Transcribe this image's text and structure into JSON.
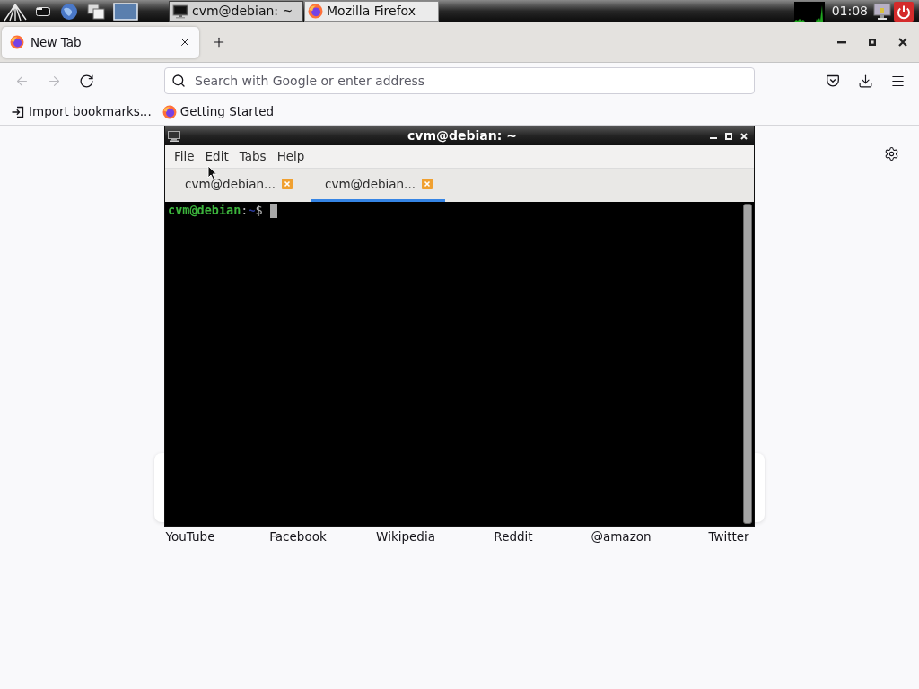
{
  "taskbar": {
    "tasks": [
      {
        "title": "cvm@debian: ~",
        "kind": "terminal",
        "selected": true
      },
      {
        "title": "Mozilla Firefox",
        "kind": "firefox",
        "selected": false
      }
    ],
    "clock": "01:08"
  },
  "browser": {
    "tabs": [
      {
        "title": "New Tab",
        "selected": true
      }
    ],
    "nav_buttons": [
      {
        "kind": "back",
        "disabled": true
      },
      {
        "kind": "forward",
        "disabled": true
      },
      {
        "kind": "reload",
        "disabled": false
      }
    ],
    "address_bar": {
      "placeholder": "Search with Google or enter address"
    },
    "bookmarks": [
      {
        "label": "Import bookmarks...",
        "kind": "import"
      },
      {
        "label": "Getting Started",
        "kind": "firefox"
      }
    ],
    "shortcuts": [
      {
        "label": "YouTube"
      },
      {
        "label": "Facebook"
      },
      {
        "label": "Wikipedia"
      },
      {
        "label": "Reddit"
      },
      {
        "label": "@amazon"
      },
      {
        "label": "Twitter"
      }
    ]
  },
  "terminal": {
    "title": "cvm@debian: ~",
    "menu": [
      "File",
      "Edit",
      "Tabs",
      "Help"
    ],
    "tabs": [
      {
        "title": "cvm@debian...",
        "selected": false
      },
      {
        "title": "cvm@debian...",
        "selected": true
      }
    ],
    "prompt": {
      "user_host": "cvm@debian",
      "separator": ":",
      "path": "~",
      "symbol": "$"
    }
  }
}
